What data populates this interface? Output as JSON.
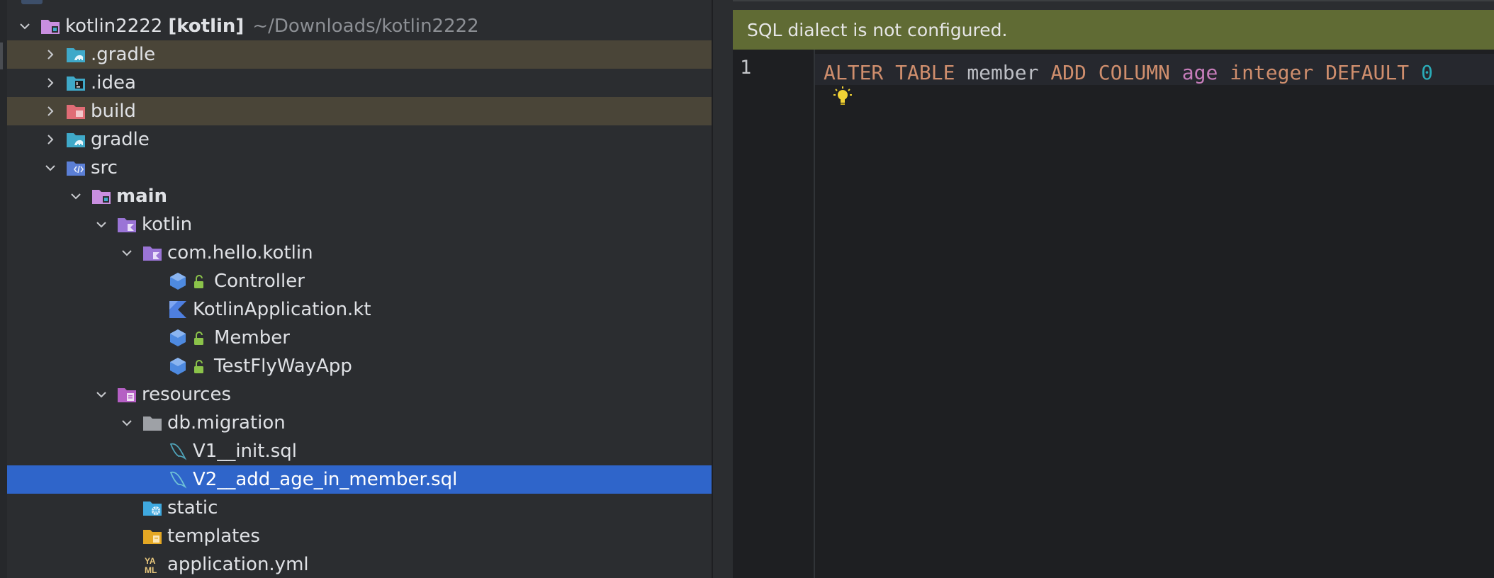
{
  "project_tree": {
    "root": {
      "name": "kotlin2222",
      "module": "[kotlin]",
      "path": "~/Downloads/kotlin2222"
    },
    "items": [
      {
        "label": ".gradle"
      },
      {
        "label": ".idea"
      },
      {
        "label": "build"
      },
      {
        "label": "gradle"
      },
      {
        "label": "src"
      },
      {
        "label": "main"
      },
      {
        "label": "kotlin"
      },
      {
        "label": "com.hello.kotlin"
      },
      {
        "label": "Controller"
      },
      {
        "label": "KotlinApplication.kt"
      },
      {
        "label": "Member"
      },
      {
        "label": "TestFlyWayApp"
      },
      {
        "label": "resources"
      },
      {
        "label": "db.migration"
      },
      {
        "label": "V1__init.sql"
      },
      {
        "label": "V2__add_age_in_member.sql"
      },
      {
        "label": "static"
      },
      {
        "label": "templates"
      },
      {
        "label": "application.yml"
      }
    ]
  },
  "editor": {
    "banner": "SQL dialect is not configured.",
    "line_number": "1",
    "tokens": {
      "alter": "ALTER",
      "table": "TABLE",
      "member": "member",
      "add": "ADD",
      "column": "COLUMN",
      "age": "age",
      "integer": "integer",
      "default": "DEFAULT",
      "zero": "0"
    }
  },
  "colors": {
    "selection": "#2f65ca",
    "highlight_row": "#4a4538",
    "banner_bg": "#606b34",
    "keyword": "#cf8e6d",
    "column": "#c77dbb",
    "number": "#2aacb8"
  },
  "icons": [
    "chevron-down-icon",
    "chevron-right-icon",
    "folder-icon",
    "kotlin-file-icon",
    "class-icon",
    "lock-icon",
    "sql-file-icon",
    "yaml-file-icon",
    "bulb-icon"
  ]
}
